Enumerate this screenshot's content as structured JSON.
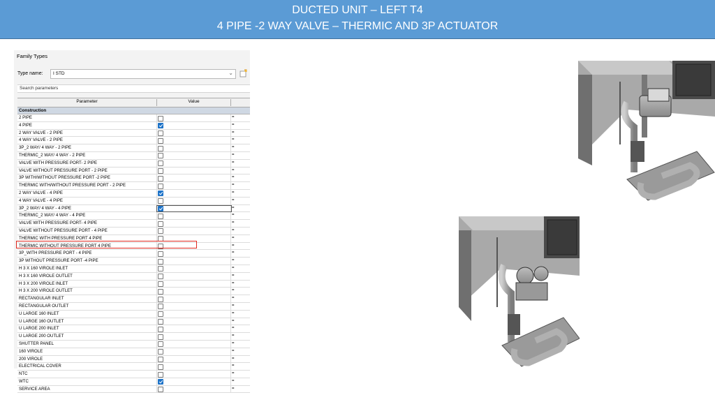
{
  "banner": {
    "title": "DUCTED UNIT – LEFT T4",
    "subtitle": "4 PIPE -2 WAY VALVE – THERMIC AND 3P ACTUATOR"
  },
  "panel": {
    "title": "Family Types",
    "type_label": "Type name:",
    "type_value": "I STD",
    "search_placeholder": "Search parameters",
    "col_parameter": "Parameter",
    "col_value": "Value",
    "group": "Construction",
    "eq": "="
  },
  "rows": [
    {
      "name": "2 PIPE",
      "checked": false
    },
    {
      "name": "4 PIPE",
      "checked": true
    },
    {
      "name": "2 WAY  VALVE - 2 PIPE",
      "checked": false
    },
    {
      "name": "4 WAY VALVE - 2 PIPE",
      "checked": false
    },
    {
      "name": "3P_2 WAY/ 4 WAY - 2 PIPE",
      "checked": false
    },
    {
      "name": "THERMIC_2 WAY/ 4 WAY - 2 PIPE",
      "checked": false
    },
    {
      "name": "VALVE WITH PRESSURE PORT- 2 PIPE",
      "checked": false
    },
    {
      "name": "VALVE WITHOUT PRESSURE PORT - 2  PIPE",
      "checked": false
    },
    {
      "name": "3P WITH/WITHOUT PRESSURE PORT -2 PIPE",
      "checked": false
    },
    {
      "name": "THERMIC WITH/WITHOUT PRESSURE PORT - 2 PIPE",
      "checked": false
    },
    {
      "name": "2 WAY VALVE - 4 PIPE",
      "checked": true
    },
    {
      "name": "4 WAY VALVE - 4 PIPE",
      "checked": false
    },
    {
      "name": "3P_2 WAY/ 4 WAY - 4 PIPE",
      "checked": true,
      "editing": true
    },
    {
      "name": "THERMIC_2 WAY/ 4 WAY - 4 PIPE",
      "checked": false
    },
    {
      "name": "VALVE WITH PRESSURE PORT- 4 PIPE",
      "checked": false
    },
    {
      "name": "VALVE WITHOUT PRESSURE PORT - 4 PIPE",
      "checked": false
    },
    {
      "name": "THERMIC WITH PRESSURE PORT 4 PIPE",
      "checked": false
    },
    {
      "name": "THERMIC WITHOUT PRESSURE PORT  4 PIPE",
      "checked": false
    },
    {
      "name": "3P_WITH PRESSURE PORT - 4 PIPE",
      "checked": false
    },
    {
      "name": "3P WITHOUT PRESSURE PORT -4  PIPE",
      "checked": false
    },
    {
      "name": "H  3 X 160 VIROLE INLET",
      "checked": false
    },
    {
      "name": "H  3 X 160 VIROLE OUTLET",
      "checked": false
    },
    {
      "name": "H  3 X 200 VIROLE INLET",
      "checked": false
    },
    {
      "name": "H  3 X 200 VIROLE OUTLET",
      "checked": false
    },
    {
      "name": "RECTANGULAR INLET",
      "checked": false
    },
    {
      "name": "RECTANGULAR OUTLET",
      "checked": false
    },
    {
      "name": "U LARGE 160 INLET",
      "checked": false
    },
    {
      "name": "U LARGE 160 OUTLET",
      "checked": false
    },
    {
      "name": "U LARGE 200 INLET",
      "checked": false
    },
    {
      "name": "U LARGE 200 OUTLET",
      "checked": false
    },
    {
      "name": "SHUTTER PANEL",
      "checked": false
    },
    {
      "name": "160 VIROLE",
      "checked": false
    },
    {
      "name": "200 VIROLE",
      "checked": false
    },
    {
      "name": "ELECTRICAL COVER",
      "checked": false
    },
    {
      "name": "NTC",
      "checked": false
    },
    {
      "name": "WTC",
      "checked": true
    },
    {
      "name": "SERVICE AREA",
      "checked": false
    }
  ],
  "colors": {
    "banner": "#5b9bd5",
    "checkbox_on": "#1e73c8",
    "highlight": "#e0281e"
  }
}
